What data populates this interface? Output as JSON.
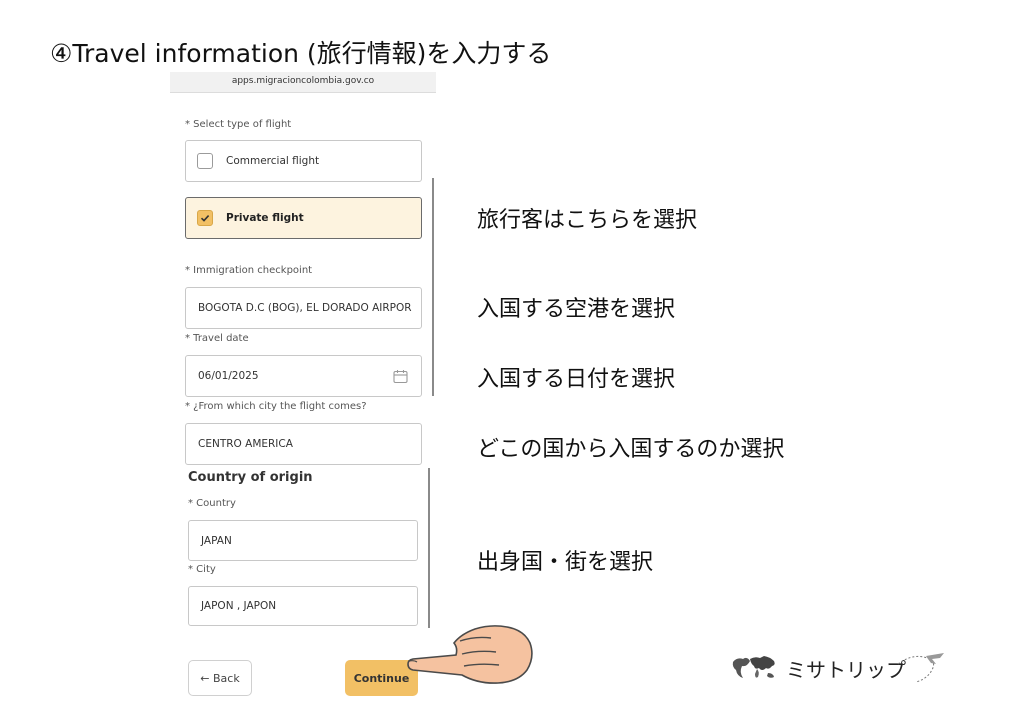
{
  "title": "④Travel information (旅行情報)を入力する",
  "browser": {
    "url": "apps.migracioncolombia.gov.co"
  },
  "form": {
    "flight_type_label": "* Select type of flight",
    "options": [
      {
        "label": "Commercial flight",
        "checked": false
      },
      {
        "label": "Private flight",
        "checked": true
      }
    ],
    "checkpoint_label": "* Immigration checkpoint",
    "checkpoint_value": "BOGOTA D.C (BOG), EL DORADO AIRPOR",
    "travel_date_label": "* Travel date",
    "travel_date_value": "06/01/2025",
    "from_city_label": "* ¿From which city the flight comes?",
    "from_city_value": "CENTRO AMERICA",
    "origin_heading": "Country of origin",
    "country_label": "* Country",
    "country_value": "JAPAN",
    "city_label": "* City",
    "city_value": "JAPON , JAPON",
    "back_label": "← Back",
    "continue_label": "Continue"
  },
  "annotations": {
    "flight_type": "旅行客はこちらを選択",
    "airport": "入国する空港を選択",
    "date": "入国する日付を選択",
    "from_country": "どこの国から入国するのか選択",
    "origin": "出身国・街を選択"
  },
  "brand": {
    "name": "ミサトリップ"
  },
  "colors": {
    "accent": "#f2c065",
    "selected_bg": "#fdf3df",
    "selected_border": "#6b6b6b"
  }
}
